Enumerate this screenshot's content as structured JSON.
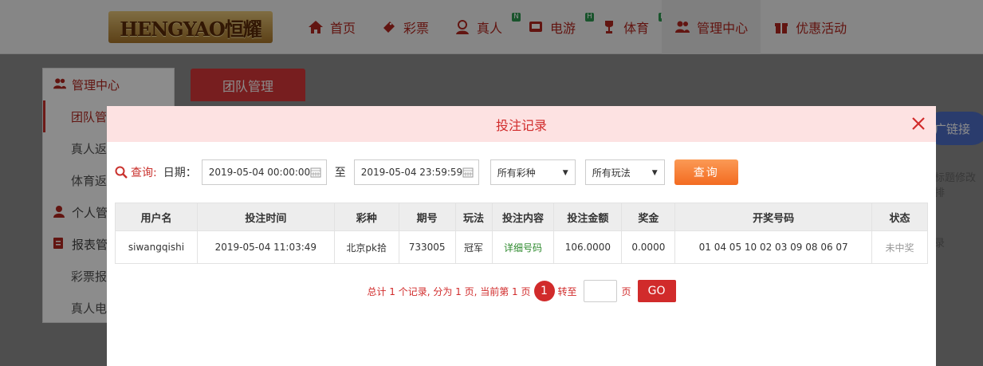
{
  "logo_text": "HENGYAO恒耀",
  "nav": [
    {
      "label": "首页",
      "icon": "home-icon"
    },
    {
      "label": "彩票",
      "icon": "ticket-icon"
    },
    {
      "label": "真人",
      "icon": "dealer-icon",
      "badge": "N"
    },
    {
      "label": "电游",
      "icon": "slot-icon",
      "badge": "H"
    },
    {
      "label": "体育",
      "icon": "trophy-icon",
      "badge": "N"
    },
    {
      "label": "管理中心",
      "icon": "users-icon",
      "active": true
    },
    {
      "label": "优惠活动",
      "icon": "gift-icon"
    }
  ],
  "sidebar": {
    "items": [
      {
        "label": "管理中心",
        "icon": "users-icon",
        "type": "head"
      },
      {
        "label": "团队管",
        "type": "cur"
      },
      {
        "label": "真人返",
        "type": "sub"
      },
      {
        "label": "体育返",
        "type": "sub"
      },
      {
        "label": "个人管",
        "icon": "person-icon",
        "type": "head2"
      },
      {
        "label": "报表管",
        "icon": "report-icon",
        "type": "head2"
      },
      {
        "label": "彩票报",
        "type": "sub"
      },
      {
        "label": "真人电",
        "type": "sub"
      }
    ]
  },
  "main": {
    "tab": "团队管理",
    "promo": "广链接",
    "right_text_1": "标题修改排",
    "right_text_2": "录"
  },
  "modal": {
    "title": "投注记录",
    "query_label": "查询:",
    "date_label": "日期：",
    "date_from": "2019-05-04 00:00:00",
    "to_label": "至",
    "date_to": "2019-05-04 23:59:59",
    "lottery_select": "所有彩种",
    "play_select": "所有玩法",
    "query_button": "查询"
  },
  "table": {
    "headers": [
      "用户名",
      "投注时间",
      "彩种",
      "期号",
      "玩法",
      "投注内容",
      "投注金额",
      "奖金",
      "开奖号码",
      "状态"
    ],
    "rows": [
      [
        "siwangqishi",
        "2019-05-04 11:03:49",
        "北京pk拾",
        "733005",
        "冠军",
        "详细号码",
        "106.0000",
        "0.0000",
        "01 04 05 10 02 03 09 08 06 07",
        "未中奖"
      ]
    ]
  },
  "pager": {
    "summary": "总计 1 个记录, 分为 1 页, 当前第 1 页",
    "current": "1",
    "goto_label": "转至",
    "page_label": "页",
    "go_button": "GO"
  },
  "colors": {
    "accent": "#d12b2b",
    "orange": "#f36b21",
    "link_green": "#2e8a2e"
  }
}
